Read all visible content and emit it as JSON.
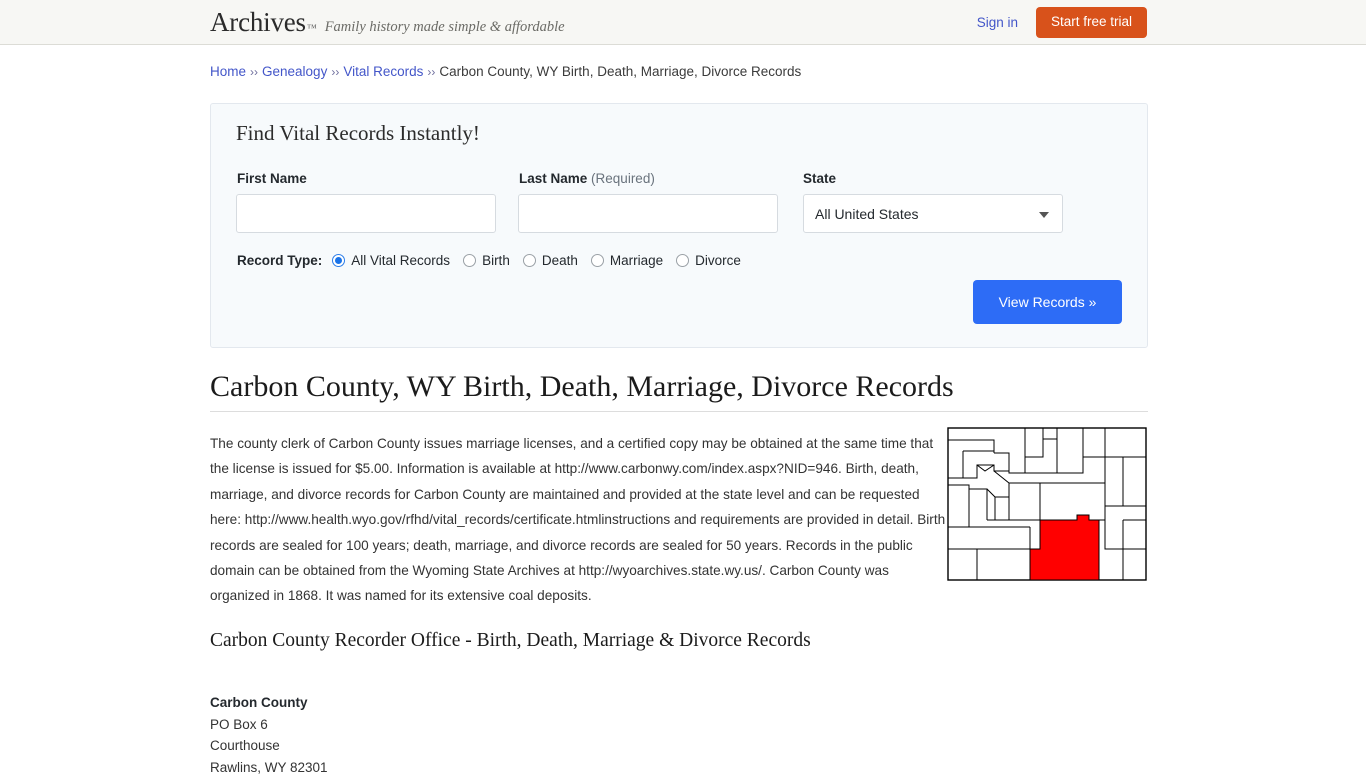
{
  "header": {
    "brand": "Archives",
    "brand_tm": "™",
    "tagline": "Family history made simple & affordable",
    "signin_label": "Sign in",
    "trial_label": "Start free trial",
    "trial_color": "#d8521b"
  },
  "breadcrumb": {
    "items": [
      {
        "label": "Home",
        "link": true
      },
      {
        "label": "Genealogy",
        "link": true
      },
      {
        "label": "Vital Records",
        "link": true
      },
      {
        "label": "Carbon County, WY Birth, Death, Marriage, Divorce Records",
        "link": false
      }
    ],
    "separator": "››"
  },
  "search_panel": {
    "title": "Find Vital Records Instantly!",
    "first_name": {
      "label": "First Name",
      "value": "",
      "placeholder": ""
    },
    "last_name": {
      "label": "Last Name",
      "required_note": "(Required)",
      "value": "",
      "placeholder": ""
    },
    "state": {
      "label": "State",
      "selected": "All United States"
    },
    "record_type": {
      "label": "Record Type:",
      "options": [
        {
          "label": "All Vital Records",
          "checked": true
        },
        {
          "label": "Birth",
          "checked": false
        },
        {
          "label": "Death",
          "checked": false
        },
        {
          "label": "Marriage",
          "checked": false
        },
        {
          "label": "Divorce",
          "checked": false
        }
      ]
    },
    "submit_label": "View Records »",
    "submit_color": "#2d6cf6"
  },
  "main": {
    "heading": "Carbon County, WY Birth, Death, Marriage, Divorce Records",
    "paragraph": "The county clerk of Carbon County issues marriage licenses, and a certified copy may be obtained at the same time that the license is issued for $5.00. Information is available at http://www.carbonwy.com/index.aspx?NID=946. Birth, death, marriage, and divorce records for Carbon County are maintained and provided at the state level and can be requested here: http://www.health.wyo.gov/rfhd/vital_records/certificate.htmlinstructions and requirements are provided in detail. Birth records are sealed for 100 years; death, marriage, and divorce records are sealed for 50 years. Records in the public domain can be obtained from the Wyoming State Archives at http://wyoarchives.state.wy.us/. Carbon County was organized in 1868. It was named for its extensive coal deposits.",
    "map": {
      "name": "wyoming-county-map",
      "highlight_county": "Carbon",
      "highlight_color": "#ff0000",
      "outline_color": "#000000"
    }
  },
  "recorder": {
    "heading": "Carbon County Recorder Office - Birth, Death, Marriage & Divorce Records",
    "address": {
      "name": "Carbon County",
      "line1": "PO Box 6",
      "line2": "Courthouse",
      "line3": "Rawlins, WY 82301"
    }
  }
}
